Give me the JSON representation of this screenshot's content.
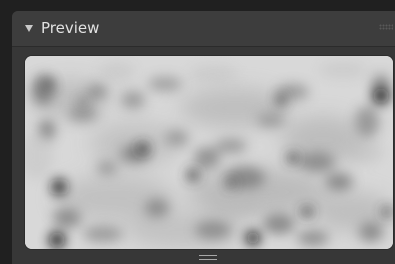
{
  "panel": {
    "title": "Preview"
  },
  "icons": {
    "collapse": "triangle-down-icon",
    "drag": "grip-icon",
    "resize": "resize-handle-icon"
  },
  "colors": {
    "panel_background": "#373737",
    "header_background": "#3d3d3d",
    "preview_background": "#d9d9d9",
    "text": "#e2e2e2"
  }
}
